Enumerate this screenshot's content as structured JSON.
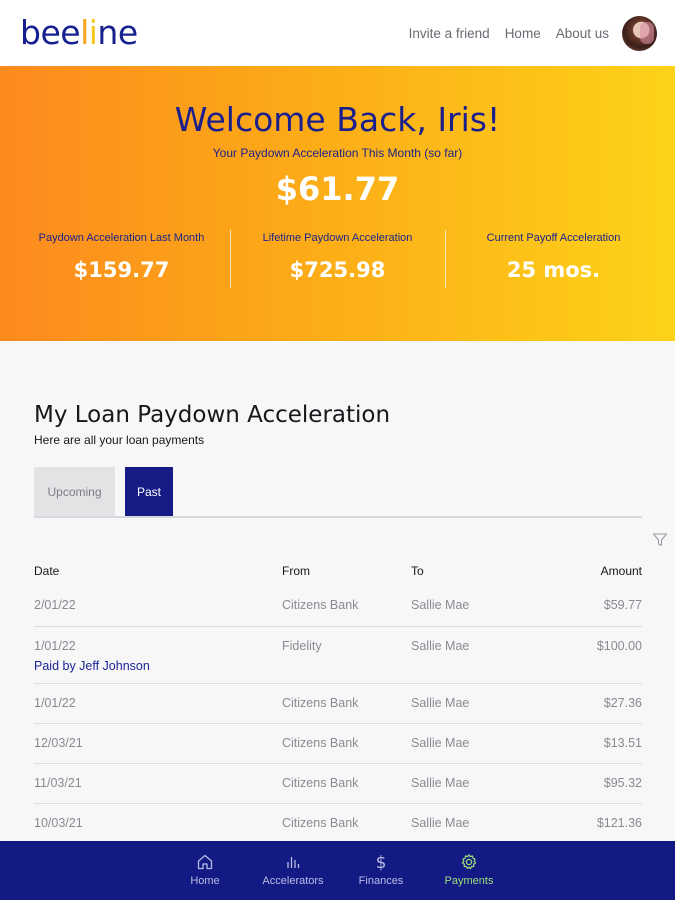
{
  "header": {
    "logo_part1": "bee",
    "logo_part2": "l",
    "logo_part3": "i",
    "logo_part4": "ne",
    "nav": [
      "Invite a friend",
      "Home",
      "About us"
    ]
  },
  "hero": {
    "welcome": "Welcome Back, Iris!",
    "subtitle": "Your Paydown Acceleration This Month (so far)",
    "amount": "$61.77",
    "stats": [
      {
        "label": "Paydown Acceleration Last Month",
        "value": "$159.77"
      },
      {
        "label": "Lifetime Paydown Acceleration",
        "value": "$725.98"
      },
      {
        "label": "Current Payoff Acceleration",
        "value": "25 mos."
      }
    ]
  },
  "main": {
    "title": "My Loan Paydown Acceleration",
    "subtitle": "Here are all your loan payments",
    "tabs": [
      {
        "label": "Upcoming",
        "active": false
      },
      {
        "label": "Past",
        "active": true
      }
    ],
    "columns": [
      "Date",
      "From",
      "To",
      "Amount"
    ],
    "rows": [
      {
        "date": "2/01/22",
        "from": "Citizens Bank",
        "to": "Sallie Mae",
        "amount": "$59.77",
        "note": ""
      },
      {
        "date": "1/01/22",
        "from": "Fidelity",
        "to": "Sallie Mae",
        "amount": "$100.00",
        "note": "Paid by Jeff Johnson"
      },
      {
        "date": "1/01/22",
        "from": "Citizens Bank",
        "to": "Sallie Mae",
        "amount": "$27.36",
        "note": ""
      },
      {
        "date": "12/03/21",
        "from": "Citizens Bank",
        "to": "Sallie Mae",
        "amount": "$13.51",
        "note": ""
      },
      {
        "date": "11/03/21",
        "from": "Citizens Bank",
        "to": "Sallie Mae",
        "amount": "$95.32",
        "note": ""
      },
      {
        "date": "10/03/21",
        "from": "Citizens Bank",
        "to": "Sallie Mae",
        "amount": "$121.36",
        "note": ""
      }
    ]
  },
  "bottom_nav": [
    {
      "label": "Home",
      "icon": "home-icon",
      "active": false
    },
    {
      "label": "Accelerators",
      "icon": "bar-chart-icon",
      "active": false
    },
    {
      "label": "Finances",
      "icon": "dollar-icon",
      "active": false
    },
    {
      "label": "Payments",
      "icon": "gear-icon",
      "active": true
    }
  ],
  "colors": {
    "brand_navy": "#161b86",
    "hero_start": "#fc8a1e",
    "hero_end": "#fdd219",
    "active_nav": "#9bde7a"
  }
}
